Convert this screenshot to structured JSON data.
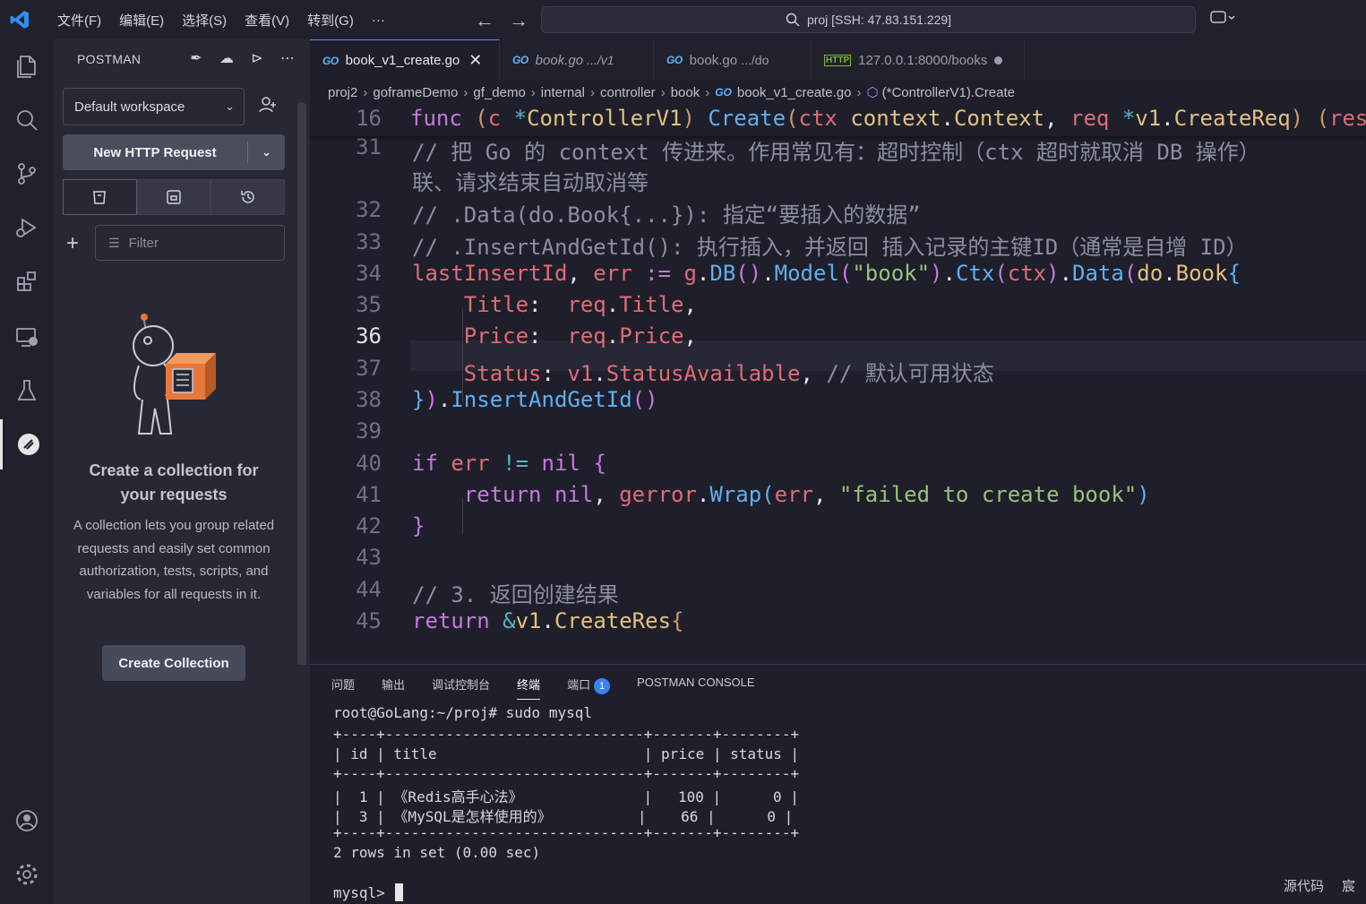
{
  "titlebar": {
    "menus": [
      "文件(F)",
      "编辑(E)",
      "选择(S)",
      "查看(V)",
      "转到(G)",
      "···"
    ],
    "search_text": "proj [SSH: 47.83.151.229]"
  },
  "activity": [
    "explorer-icon",
    "search-icon",
    "source-control-icon",
    "run-debug-icon",
    "extensions-icon",
    "remote-explorer-icon",
    "testing-icon",
    "postman-icon",
    "account-icon",
    "settings-icon"
  ],
  "sidebar": {
    "header": "POSTMAN",
    "workspace": "Default workspace",
    "new_request": "New HTTP Request",
    "filter_placeholder": "Filter",
    "empty_title": "Create a collection for your requests",
    "empty_desc": "A collection lets you group related requests and easily set common authorization, tests, scripts, and variables for all requests in it.",
    "create_button": "Create Collection"
  },
  "tabs": [
    {
      "label": "book_v1_create.go",
      "icon": "GO",
      "active": true
    },
    {
      "label": "book.go",
      "path": ".../v1",
      "icon": "GO"
    },
    {
      "label": "book.go",
      "path": ".../do",
      "icon": "GO"
    },
    {
      "label": "127.0.0.1:8000/books",
      "icon": "HTTP"
    }
  ],
  "breadcrumb": {
    "items": [
      "proj2",
      "goframeDemo",
      "gf_demo",
      "internal",
      "controller",
      "book",
      "book_v1_create.go",
      "(*ControllerV1).Create"
    ]
  },
  "code": {
    "sticky_line": "16",
    "line_numbers": [
      "31",
      "32",
      "33",
      "34",
      "35",
      "36",
      "37",
      "38",
      "39",
      "40",
      "41",
      "42",
      "43",
      "44",
      "45"
    ],
    "current_line": "36"
  },
  "panel": {
    "tabs": [
      "问题",
      "输出",
      "调试控制台",
      "终端",
      "端口",
      "POSTMAN CONSOLE"
    ],
    "active_tab": "终端",
    "ports_badge": "1",
    "terminal": {
      "prompt": "root@GoLang:~/proj# sudo mysql",
      "border": "+----+------------------------------+-------+--------+",
      "header": "| id | title                        | price | status |",
      "rows": [
        "|  1 | 《Redis高手心法》              |   100 |      0 |",
        "|  3 | 《MySQL是怎样使用的》          |    66 |      0 |"
      ],
      "summary": "2 rows in set (0.00 sec)",
      "mysql_prompt": "mysql>"
    },
    "status_right": [
      "源代码",
      "宸"
    ]
  }
}
